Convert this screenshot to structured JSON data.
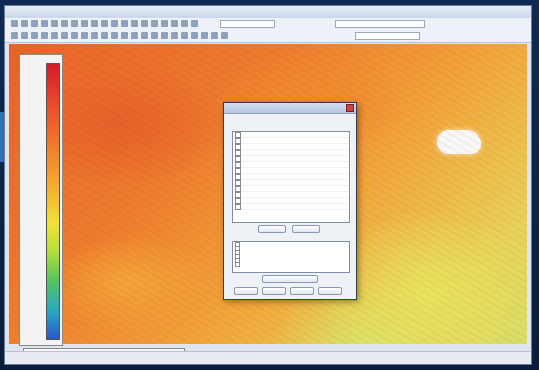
{
  "colors": {
    "side_tab": "#2f6fb8",
    "window_bg": "#dfe5ee",
    "dialog_bg": "#eef1f6"
  },
  "icons": {
    "window_close": "close-icon"
  },
  "toolbar": {
    "combo_1": "",
    "combo_2": "",
    "combo_3": ""
  },
  "legend": {
    "ticks": [
      "",
      "",
      "",
      "",
      "",
      ""
    ]
  },
  "scale": {
    "labels": [
      "",
      "",
      "",
      "",
      ""
    ]
  },
  "dialog": {
    "title": "",
    "group_label": "",
    "list_items": [
      "",
      "",
      "",
      "",
      "",
      "",
      "",
      "",
      "",
      "",
      "",
      "",
      ""
    ],
    "button_a": "",
    "button_b": "",
    "section_label": "",
    "list2_items": [
      "",
      "",
      "",
      "",
      "",
      ""
    ],
    "button_c": "",
    "button_ok": "",
    "button_cancel": "",
    "button_apply": "",
    "button_help": ""
  },
  "statusbar": {
    "left": "",
    "right": ""
  }
}
